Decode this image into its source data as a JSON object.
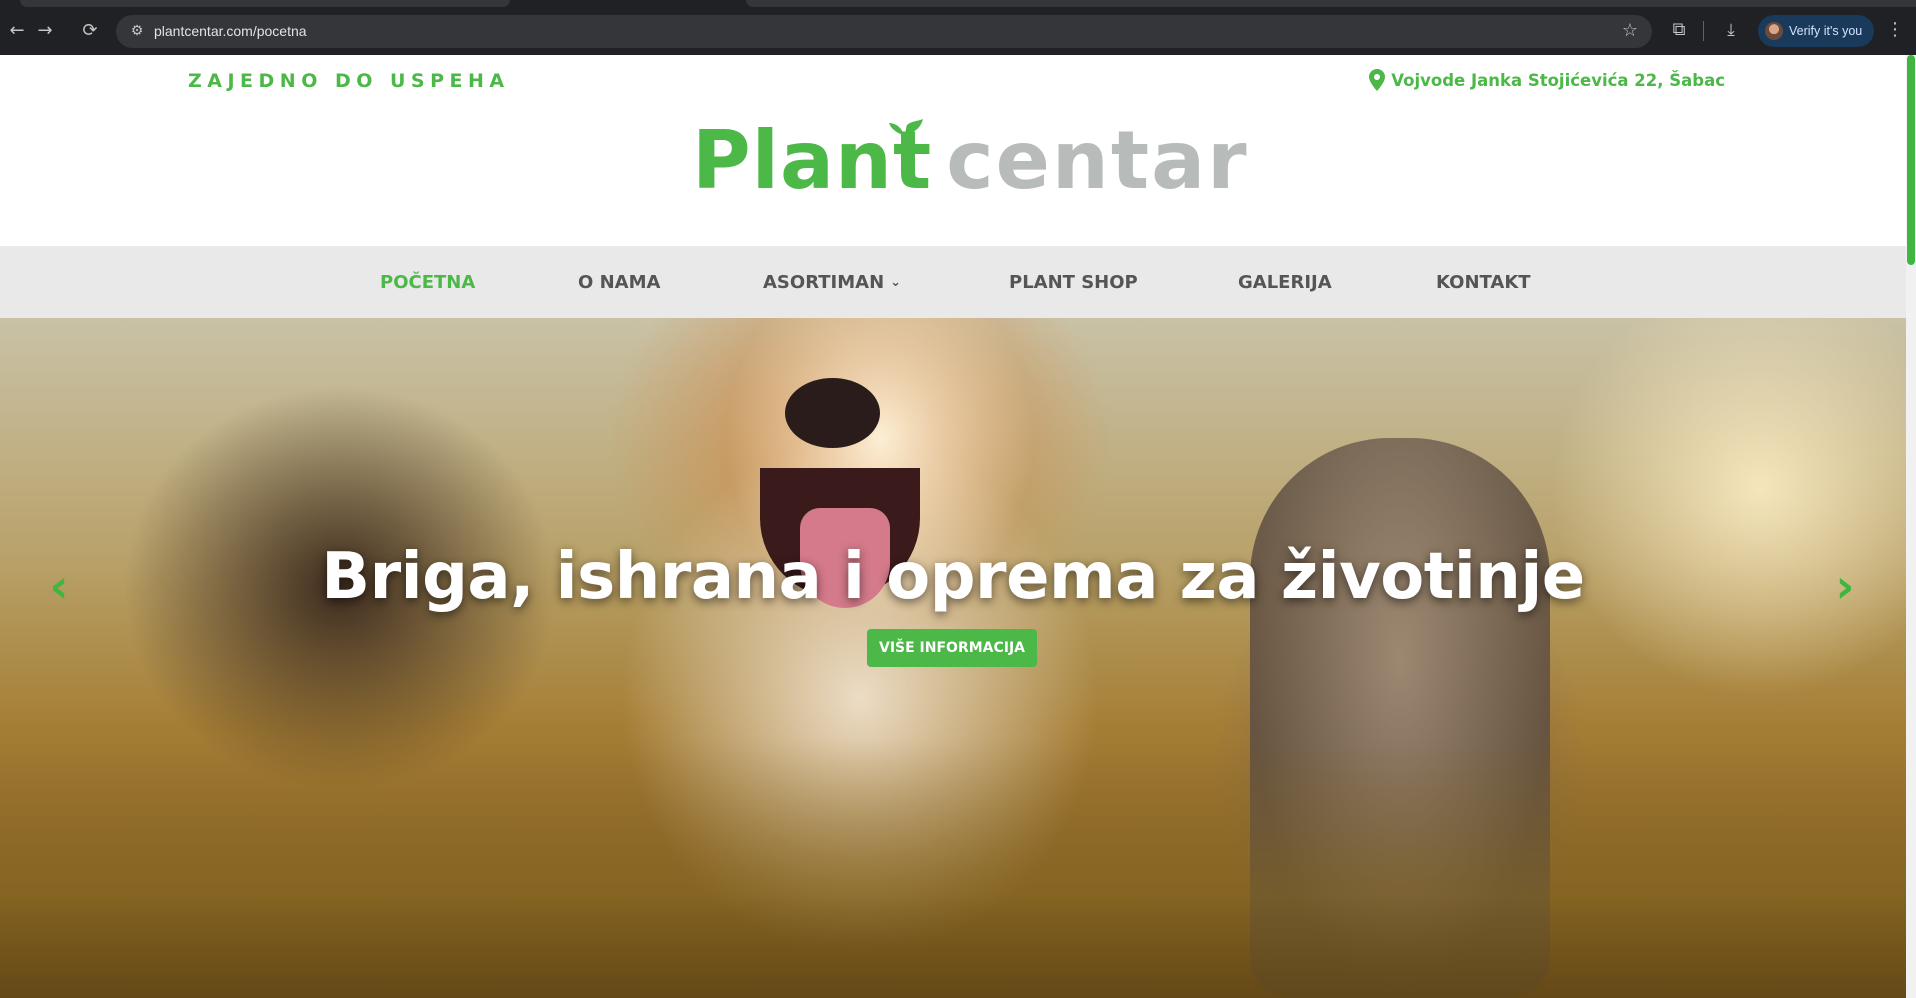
{
  "browser": {
    "url": "plantcentar.com/pocetna",
    "back_icon": "←",
    "forward_icon": "→",
    "reload_icon": "⟳",
    "site_settings_icon": "⚙",
    "star_icon": "☆",
    "extensions_icon": "⧉",
    "download_icon": "⤓",
    "menu_icon": "⋮",
    "profile_label": "Verify it's you"
  },
  "header": {
    "tagline": "ZAJEDNO DO USPEHA",
    "address": "Vojvode Janka Stojićevića 22, Šabac",
    "logo_part1": "Plant",
    "logo_part2": "centar",
    "brand_green": "#4cb848",
    "brand_gray": "#b7bcbb"
  },
  "nav": {
    "items": [
      {
        "label": "POČETNA",
        "active": true
      },
      {
        "label": "O NAMA",
        "active": false
      },
      {
        "label": "ASORTIMAN",
        "active": false,
        "dropdown": true
      },
      {
        "label": "PLANT SHOP",
        "active": false
      },
      {
        "label": "GALERIJA",
        "active": false
      },
      {
        "label": "KONTAKT",
        "active": false
      }
    ],
    "dropdown_icon": "⌄"
  },
  "hero": {
    "title": "Briga, ishrana i oprema za životinje",
    "button_label": "VIŠE INFORMACIJA",
    "prev_icon": "‹",
    "next_icon": "›"
  }
}
